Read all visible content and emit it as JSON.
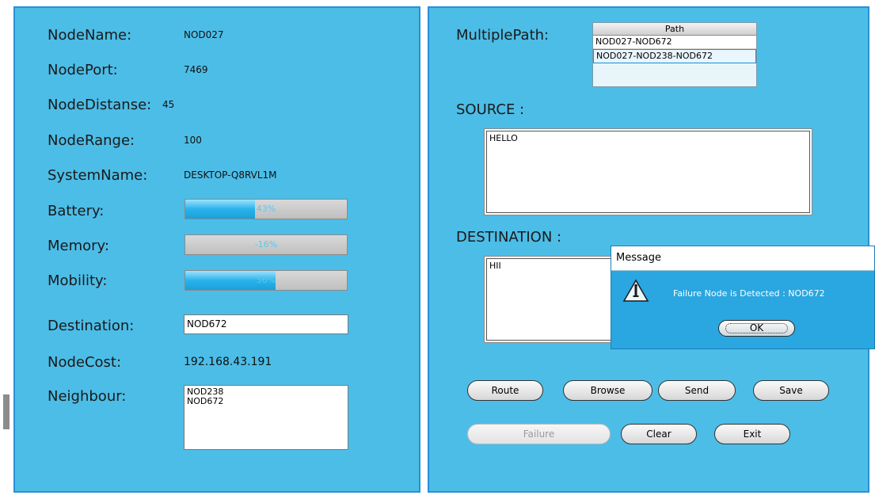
{
  "node_info": {
    "node_name_label": "NodeName:",
    "node_name_value": "NOD027",
    "node_port_label": "NodePort:",
    "node_port_value": "7469",
    "node_distance_label": "NodeDistanse:",
    "node_distance_value": "45",
    "node_range_label": "NodeRange:",
    "node_range_value": "100",
    "system_name_label": "SystemName:",
    "system_name_value": "DESKTOP-Q8RVL1M"
  },
  "meters": {
    "battery_label": "Battery:",
    "battery_text": "43%",
    "battery_fraction": 0.43,
    "memory_label": "Memory:",
    "memory_text": "-16%",
    "memory_fraction": 0.0,
    "mobility_label": "Mobility:",
    "mobility_text": "56%",
    "mobility_fraction": 0.56
  },
  "destination": {
    "label": "Destination:",
    "value": "NOD672"
  },
  "node_cost": {
    "label": "NodeCost:",
    "value": "192.168.43.191"
  },
  "neighbour": {
    "label": "Neighbour:",
    "items": [
      "NOD238",
      "NOD672"
    ]
  },
  "multiple_path": {
    "label": "MultiplePath:",
    "column_header": "Path",
    "rows": [
      "NOD027-NOD672",
      "NOD027-NOD238-NOD672"
    ],
    "selected_index": 1
  },
  "source": {
    "label": "SOURCE :",
    "text": "HELLO"
  },
  "destination_msg": {
    "label": "DESTINATION :",
    "text": "HII"
  },
  "buttons": {
    "route": "Route",
    "browse": "Browse",
    "send": "Send",
    "save": "Save",
    "failure": "Failure",
    "clear": "Clear",
    "exit": "Exit"
  },
  "dialog": {
    "title": "Message",
    "message": "Failure Node is Detected : NOD672",
    "ok": "OK",
    "icon": "warning-icon"
  },
  "colors": {
    "panel_bg": "#4cbde7",
    "panel_border": "#2a8fd6",
    "dialog_bg": "#2aa6e0",
    "progress_fill": "#29b3ea"
  }
}
